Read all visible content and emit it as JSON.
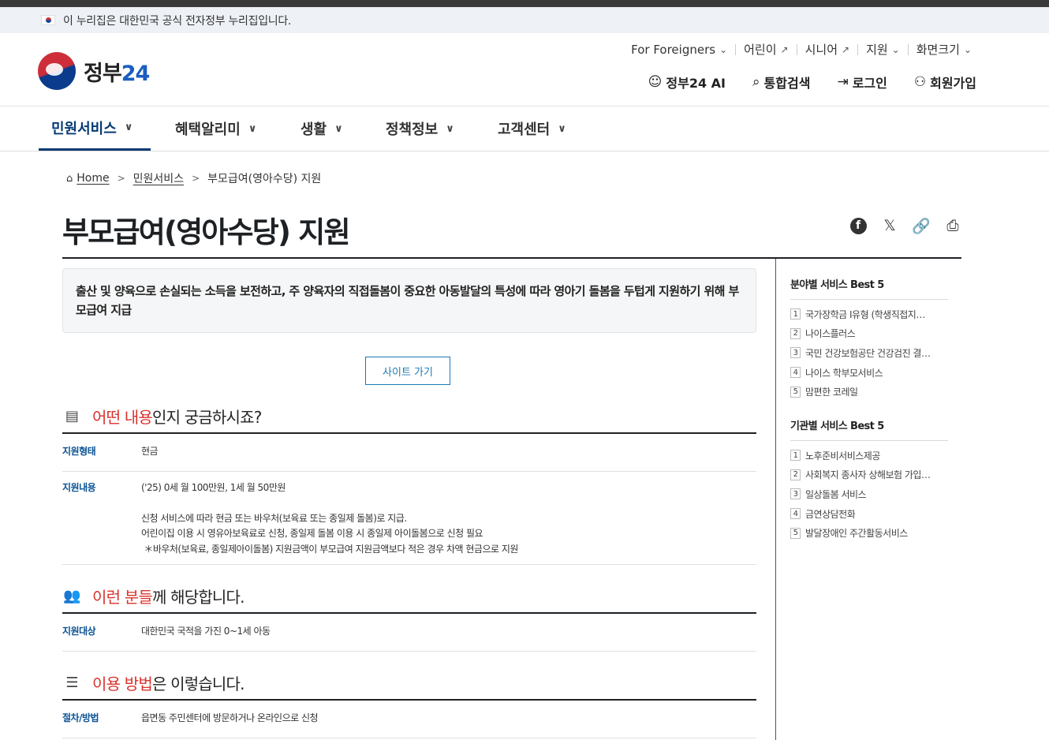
{
  "gov_banner": {
    "text": "이 누리집은 대한민국 공식 전자정부 누리집입니다."
  },
  "logo": {
    "text_main": "정부",
    "text_num": "24"
  },
  "util_links": [
    {
      "label": "For Foreigners",
      "icon": "chevron-down-icon"
    },
    {
      "label": "어린이",
      "icon": "external-link-icon"
    },
    {
      "label": "시니어",
      "icon": "external-link-icon"
    },
    {
      "label": "지원",
      "icon": "chevron-down-icon"
    },
    {
      "label": "화면크기",
      "icon": "chevron-down-icon"
    }
  ],
  "main_links": [
    {
      "label": "정부24 AI",
      "icon": "ai-robot-icon"
    },
    {
      "label": "통합검색",
      "icon": "search-icon"
    },
    {
      "label": "로그인",
      "icon": "login-icon"
    },
    {
      "label": "회원가입",
      "icon": "user-add-icon"
    }
  ],
  "gnb": [
    {
      "label": "민원서비스",
      "active": true
    },
    {
      "label": "혜택알리미"
    },
    {
      "label": "생활"
    },
    {
      "label": "정책정보"
    },
    {
      "label": "고객센터"
    }
  ],
  "breadcrumb": {
    "home": "Home",
    "level1": "민원서비스",
    "current": "부모급여(영아수당) 지원"
  },
  "page_title": "부모급여(영아수당) 지원",
  "share_icons": [
    "facebook-icon",
    "x-icon",
    "clip-link-icon",
    "print-icon"
  ],
  "summary": "출산 및 양육으로 손실되는 소득을 보전하고, 주 양육자의 직접돌봄이 중요한 아동발달의 특성에 따라 영아기 돌봄을 두텁게 지원하기 위해 부모급여 지급",
  "site_button": "사이트 가기",
  "section1": {
    "title_hl": "어떤 내용",
    "title_rest": "인지 궁금하시죠?",
    "rows": [
      {
        "key": "지원형태",
        "lines": [
          "현금"
        ]
      },
      {
        "key": "지원내용",
        "lines": [
          "('25) 0세 월 100만원, 1세 월 50만원",
          "",
          "신청 서비스에 따라 현금 또는 바우처(보육료 또는 종일제 돌봄)로 지급.",
          "어린이집 이용 시 영유아보육료로 신청, 종일제 돌봄 이용 시 종일제 아이돌봄으로 신청 필요",
          " ＊바우처(보육료, 종일제아이돌봄) 지원금액이 부모급여 지원금액보다 적은 경우 차액 현금으로 지원"
        ]
      }
    ]
  },
  "section2": {
    "title_hl": "이런 분들",
    "title_rest": "께 해당합니다.",
    "rows": [
      {
        "key": "지원대상",
        "lines": [
          "대한민국 국적을 가진 0~1세 아동"
        ]
      }
    ]
  },
  "section3": {
    "title_hl": "이용 방법",
    "title_rest": "은 이렇습니다.",
    "rows": [
      {
        "key": "절차/방법",
        "lines": [
          "읍면동 주민센터에 방문하거나 온라인으로 신청"
        ]
      }
    ]
  },
  "sidebar": {
    "field_title": "분야별 서비스 Best 5",
    "field_items": [
      "국가장학금 Ⅰ유형 (학생직접지원형)",
      "나이스플러스",
      "국민 건강보험공단 건강검진 결과조회",
      "나이스 학부모서비스",
      "맘편한 코레일"
    ],
    "org_title": "기관별 서비스 Best 5",
    "org_items": [
      "노후준비서비스제공",
      "사회복지 종사자 상해보험 가입 지원",
      "일상돌봄 서비스",
      "금연상담전화",
      "발달장애인 주간활동서비스"
    ]
  }
}
